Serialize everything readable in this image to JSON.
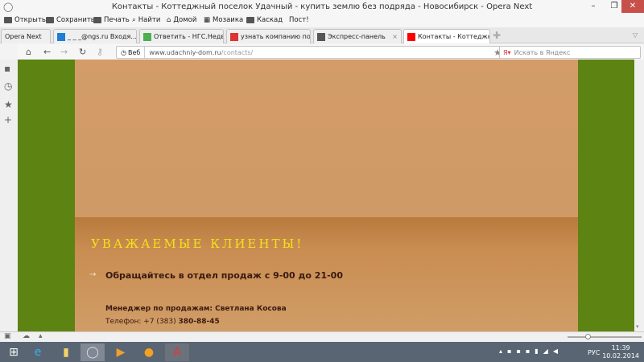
{
  "window": {
    "title": "Контакты - Коттеджный поселок Удачный - купить землю без подряда - Новосибирск - Opera Next"
  },
  "menu": [
    "Открыть",
    "Сохранить",
    "Печать",
    "Найти",
    "Домой",
    "Мозаика",
    "Каскад",
    "Пост!"
  ],
  "opera_button": "Opera Next",
  "tabs": [
    {
      "label": "_ _ _@ngs.ru Входя...",
      "color": "#1e7fd4"
    },
    {
      "label": "Ответить - НГС.Недви...",
      "color": "#4caf50"
    },
    {
      "label": "узнать компанию по ...",
      "color": "#d33"
    },
    {
      "label": "Экспресс-панель",
      "color": "#555"
    },
    {
      "label": "Контакты - Коттеджн...",
      "color": "#f00"
    }
  ],
  "address": {
    "badge": "Веб",
    "host": "www.udachniy-dom.ru",
    "path": "/contacts/",
    "search_placeholder": "Искать в Яндекс"
  },
  "content": {
    "heading": "УВАЖАЕМЫЕ КЛИЕНТЫ!",
    "hours": "Обращайтесь в отдел продаж с 9-00 до 21-00",
    "manager": "Менеджер по продажам: Светлана Косова",
    "phone_label": "Телефон: +7 (383) ",
    "phone_number": "380-88-45"
  },
  "tray": {
    "lang": "РУС",
    "time": "11:39",
    "date": "10.02.2014"
  }
}
